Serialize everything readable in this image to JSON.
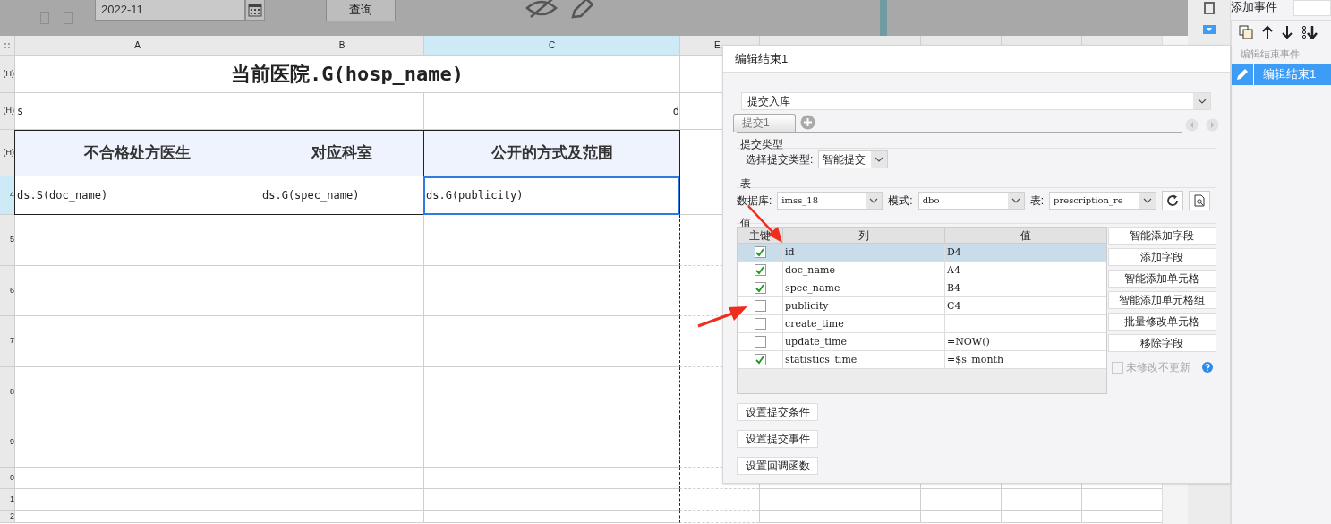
{
  "toolbar": {
    "date_field": {
      "value": "2022-11"
    },
    "query_button": "查询"
  },
  "sheet": {
    "columns": [
      {
        "label": "A",
        "selected": false
      },
      {
        "label": "B",
        "selected": false
      },
      {
        "label": "C",
        "selected": true
      },
      {
        "label": "E",
        "selected": false
      }
    ],
    "row_labels": [
      {
        "label": "(H)",
        "selected": false
      },
      {
        "label": "(H)",
        "selected": false
      },
      {
        "label": "(H)",
        "selected": false
      },
      {
        "label": "4",
        "selected": true
      },
      {
        "label": "5",
        "selected": false
      },
      {
        "label": "6",
        "selected": false
      },
      {
        "label": "7",
        "selected": false
      },
      {
        "label": "8",
        "selected": false
      },
      {
        "label": "9",
        "selected": false
      },
      {
        "label": "0",
        "selected": false
      },
      {
        "label": "1",
        "selected": false
      },
      {
        "label": "2",
        "selected": false
      }
    ],
    "title": "当前医院.G(hosp_name)",
    "subtitle_left": "s",
    "subtitle_right": "d",
    "headers": [
      "不合格处方医生",
      "对应科室",
      "公开的方式及范围"
    ],
    "data_cells": [
      {
        "text": "ds.S(doc_name)",
        "selected": false
      },
      {
        "text": "ds.G(spec_name)",
        "selected": false
      },
      {
        "text": "ds.G(publicity)",
        "selected": true
      }
    ]
  },
  "dialog": {
    "title": "编辑结束1",
    "action_select": "提交入库",
    "tabs": [
      {
        "label": "提交1",
        "selected": true
      }
    ],
    "submit_type_section": "提交类型",
    "submit_type_label": "选择提交类型:",
    "submit_type_value": "智能提交",
    "table_section": "表",
    "database_label": "数据库:",
    "database_value": "imss_18",
    "schema_label": "模式:",
    "schema_value": "dbo",
    "table_label": "表:",
    "table_value": "prescription_re",
    "values_section": "值",
    "columns": [
      "主键",
      "列",
      "值"
    ],
    "rows": [
      {
        "column": "id",
        "value": "D4",
        "key": true,
        "selected": true
      },
      {
        "column": "doc_name",
        "value": "A4",
        "key": true,
        "selected": false
      },
      {
        "column": "spec_name",
        "value": "B4",
        "key": true,
        "selected": false
      },
      {
        "column": "publicity",
        "value": "C4",
        "key": false,
        "selected": false
      },
      {
        "column": "create_time",
        "value": "",
        "key": false,
        "selected": false
      },
      {
        "column": "update_time",
        "value": "=NOW()",
        "key": false,
        "selected": false
      },
      {
        "column": "statistics_time",
        "value": "=$s_month",
        "key": true,
        "selected": false
      }
    ],
    "side_buttons": [
      "智能添加字段",
      "添加字段",
      "智能添加单元格",
      "智能添加单元格组",
      "批量修改单元格",
      "移除字段"
    ],
    "no_update_unchanged": {
      "label": "未修改不更新",
      "checked": false,
      "disabled": true
    },
    "bottom_buttons": [
      "设置提交条件",
      "设置提交事件",
      "设置回调函数"
    ]
  },
  "event_panel": {
    "title": "添加事件",
    "group": "编辑结束事件",
    "items": [
      {
        "label": "编辑结束1",
        "selected": true
      }
    ]
  }
}
